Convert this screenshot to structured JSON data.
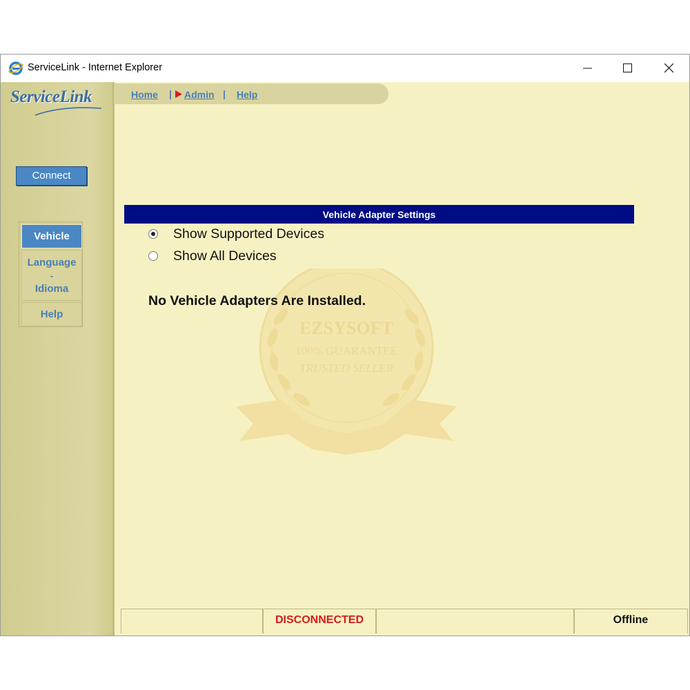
{
  "window": {
    "title": "ServiceLink - Internet Explorer",
    "icon": "internet-explorer-icon",
    "controls": [
      "minimize-icon",
      "maximize-icon",
      "close-icon"
    ]
  },
  "app": {
    "logo_text": "ServiceLink",
    "connect_label": "Connect",
    "topnav": {
      "home": "Home",
      "admin": "Admin",
      "help": "Help",
      "separator": "|"
    },
    "sidenav": {
      "vehicle": "Vehicle",
      "language_line1": "Language",
      "language_dash": "-",
      "language_line2": "Idioma",
      "help": "Help"
    }
  },
  "main": {
    "section_title": "Vehicle Adapter Settings",
    "radios": [
      {
        "label": "Show Supported Devices",
        "selected": true
      },
      {
        "label": "Show All Devices",
        "selected": false
      }
    ],
    "message": "No Vehicle Adapters Are Installed."
  },
  "watermark": {
    "line1": "EZSYSOFT",
    "line2": "100% GUARANTEE",
    "line3": "TRUSTED SELLER"
  },
  "statusbar": {
    "cell1": "",
    "connection_status": "DISCONNECTED",
    "cell3": "",
    "mode": "Offline"
  },
  "colors": {
    "content_bg": "#f6f1c3",
    "sidebar_bg": "#d6d199",
    "header_bar": "#000c84",
    "accent_blue": "#4a87c4",
    "status_red": "#d41c1c"
  }
}
